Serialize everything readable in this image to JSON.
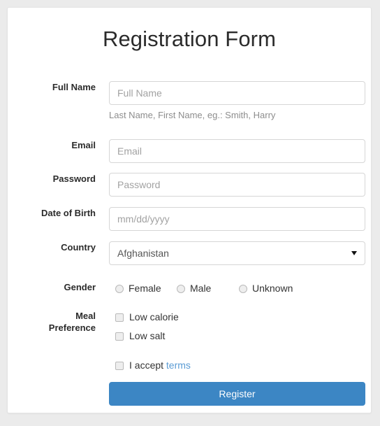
{
  "page": {
    "background_color": "#ebebeb",
    "panel_background": "#ffffff",
    "accent_color": "#3c86c4",
    "link_color": "#5a9bd4"
  },
  "form": {
    "title": "Registration Form",
    "fields": {
      "full_name": {
        "label": "Full Name",
        "placeholder": "Full Name",
        "value": "",
        "help_text": "Last Name, First Name, eg.: Smith, Harry"
      },
      "email": {
        "label": "Email",
        "placeholder": "Email",
        "value": ""
      },
      "password": {
        "label": "Password",
        "placeholder": "Password",
        "value": ""
      },
      "date_of_birth": {
        "label": "Date of Birth",
        "placeholder": "mm/dd/yyyy",
        "value": ""
      },
      "country": {
        "label": "Country",
        "selected": "Afghanistan",
        "options": [
          "Afghanistan"
        ]
      },
      "gender": {
        "label": "Gender",
        "options": [
          {
            "label": "Female",
            "checked": false
          },
          {
            "label": "Male",
            "checked": false
          },
          {
            "label": "Unknown",
            "checked": false
          }
        ]
      },
      "meal_preference": {
        "label_line1": "Meal",
        "label_line2": "Preference",
        "options": [
          {
            "label": "Low calorie",
            "checked": false
          },
          {
            "label": "Low salt",
            "checked": false
          }
        ]
      },
      "terms": {
        "text_prefix": "I accept",
        "link_label": "terms",
        "checked": false
      }
    },
    "submit": {
      "label": "Register"
    }
  }
}
